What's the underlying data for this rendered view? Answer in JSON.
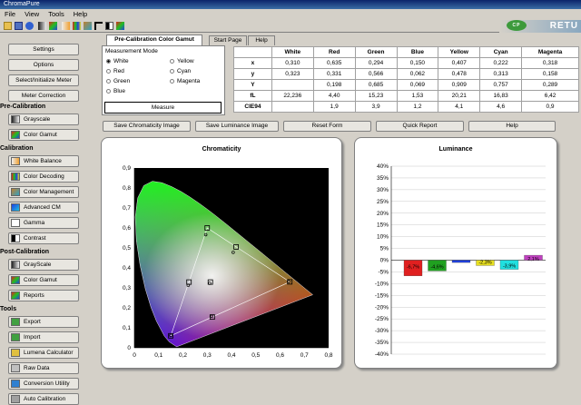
{
  "window": {
    "title": "ChromaPure",
    "brand": "RETU",
    "logo_text": "CP"
  },
  "menu": [
    "File",
    "View",
    "Tools",
    "Help"
  ],
  "left": {
    "top_buttons": [
      "Settings",
      "Options",
      "Select/Initialize Meter",
      "Meter Correction"
    ],
    "sections": [
      {
        "title": "Pre-Calibration",
        "buttons": [
          {
            "label": "Grayscale",
            "icon": "grayscale-icon"
          },
          {
            "label": "Color Gamut",
            "icon": "color-gamut-icon"
          }
        ]
      },
      {
        "title": "Calibration",
        "buttons": [
          {
            "label": "White Balance",
            "icon": "white-balance-icon"
          },
          {
            "label": "Color Decoding",
            "icon": "color-decoding-icon"
          },
          {
            "label": "Color Management",
            "icon": "color-management-icon"
          },
          {
            "label": "Advanced CM",
            "icon": "advanced-cm-icon"
          },
          {
            "label": "Gamma",
            "icon": "gamma-icon"
          },
          {
            "label": "Contrast",
            "icon": "contrast-icon"
          }
        ]
      },
      {
        "title": "Post-Calibration",
        "buttons": [
          {
            "label": "GrayScale",
            "icon": "grayscale-icon"
          },
          {
            "label": "Color Gamut",
            "icon": "color-gamut-icon"
          },
          {
            "label": "Reports",
            "icon": "reports-icon"
          }
        ]
      },
      {
        "title": "Tools",
        "buttons": [
          {
            "label": "Export",
            "icon": "export-icon"
          },
          {
            "label": "Import",
            "icon": "import-icon"
          },
          {
            "label": "Lumena Calculator",
            "icon": "calculator-icon"
          },
          {
            "label": "Raw Data",
            "icon": "raw-data-icon"
          },
          {
            "label": "Conversion Utility",
            "icon": "conversion-icon"
          },
          {
            "label": "Auto Calibration",
            "icon": "auto-calibration-icon"
          }
        ]
      }
    ]
  },
  "tabs": [
    "Pre-Calibration Color Gamut",
    "Start Page",
    "Help"
  ],
  "measurement": {
    "title": "Measurement Mode",
    "options": [
      "White",
      "Red",
      "Green",
      "Blue",
      "Yellow",
      "Cyan",
      "Magenta"
    ],
    "selected": "White",
    "measure_label": "Measure"
  },
  "table": {
    "columns": [
      "",
      "White",
      "Red",
      "Green",
      "Blue",
      "Yellow",
      "Cyan",
      "Magenta"
    ],
    "rows": [
      [
        "x",
        "0,310",
        "0,635",
        "0,294",
        "0,150",
        "0,407",
        "0,222",
        "0,318"
      ],
      [
        "y",
        "0,323",
        "0,331",
        "0,566",
        "0,062",
        "0,478",
        "0,313",
        "0,158"
      ],
      [
        "Y",
        "",
        "0,198",
        "0,685",
        "0,069",
        "0,909",
        "0,757",
        "0,289"
      ],
      [
        "fL",
        "22,236",
        "4,40",
        "15,23",
        "1,53",
        "20,21",
        "16,83",
        "6,42"
      ],
      [
        "CIE94",
        "",
        "1,9",
        "3,9",
        "1,2",
        "4,1",
        "4,6",
        "0,9"
      ]
    ]
  },
  "actions": [
    "Save Chromaticity Image",
    "Save Luminance Image",
    "Reset Form",
    "Quick Report",
    "Help"
  ],
  "chromaticity": {
    "title": "Chromaticity",
    "x_ticks": [
      "0",
      "0,1",
      "0,2",
      "0,3",
      "0,4",
      "0,5",
      "0,6",
      "0,7",
      "0,8"
    ],
    "y_ticks": [
      "0",
      "0,1",
      "0,2",
      "0,3",
      "0,4",
      "0,5",
      "0,6",
      "0,7",
      "0,8",
      "0,9"
    ],
    "targets": [
      {
        "name": "Red",
        "x": 0.64,
        "y": 0.33
      },
      {
        "name": "Green",
        "x": 0.3,
        "y": 0.6
      },
      {
        "name": "Blue",
        "x": 0.15,
        "y": 0.06
      },
      {
        "name": "Yellow",
        "x": 0.419,
        "y": 0.505
      },
      {
        "name": "Cyan",
        "x": 0.225,
        "y": 0.329
      },
      {
        "name": "Magenta",
        "x": 0.321,
        "y": 0.154
      },
      {
        "name": "White",
        "x": 0.313,
        "y": 0.329
      }
    ],
    "measured": [
      {
        "name": "Red",
        "x": 0.635,
        "y": 0.331
      },
      {
        "name": "Green",
        "x": 0.294,
        "y": 0.566
      },
      {
        "name": "Blue",
        "x": 0.15,
        "y": 0.062
      },
      {
        "name": "Yellow",
        "x": 0.407,
        "y": 0.478
      },
      {
        "name": "Cyan",
        "x": 0.222,
        "y": 0.313
      },
      {
        "name": "Magenta",
        "x": 0.318,
        "y": 0.158
      },
      {
        "name": "White",
        "x": 0.31,
        "y": 0.323
      }
    ]
  },
  "luminance": {
    "title": "Luminance",
    "y_ticks": [
      "40%",
      "35%",
      "30%",
      "25%",
      "20%",
      "15%",
      "10%",
      "5%",
      "0%",
      "-5%",
      "-10%",
      "-15%",
      "-20%",
      "-25%",
      "-30%",
      "-35%",
      "-40%"
    ],
    "bars": [
      {
        "name": "Red",
        "value": -6.7,
        "label": "-6,7%",
        "color": "#e02020"
      },
      {
        "name": "Green",
        "value": -4.6,
        "label": "-4,6%",
        "color": "#20a020"
      },
      {
        "name": "Blue",
        "value": -1.0,
        "label": "",
        "color": "#2040e0"
      },
      {
        "name": "Yellow",
        "value": -2.3,
        "label": "-2,3%",
        "color": "#e8e020"
      },
      {
        "name": "Cyan",
        "value": -3.9,
        "label": "-3,9%",
        "color": "#20e0e0"
      },
      {
        "name": "Magenta",
        "value": 2.1,
        "label": "2,1%",
        "color": "#c040c0"
      }
    ]
  },
  "chart_data": [
    {
      "type": "scatter",
      "title": "Chromaticity",
      "xlim": [
        0,
        0.8
      ],
      "ylim": [
        0,
        0.9
      ],
      "series": [
        {
          "name": "Measured",
          "points": [
            [
              0.635,
              0.331
            ],
            [
              0.294,
              0.566
            ],
            [
              0.15,
              0.062
            ],
            [
              0.407,
              0.478
            ],
            [
              0.222,
              0.313
            ],
            [
              0.318,
              0.158
            ],
            [
              0.31,
              0.323
            ]
          ]
        }
      ]
    },
    {
      "type": "bar",
      "title": "Luminance",
      "categories": [
        "Red",
        "Green",
        "Blue",
        "Yellow",
        "Cyan",
        "Magenta"
      ],
      "values": [
        -6.7,
        -4.6,
        -1.0,
        -2.3,
        -3.9,
        2.1
      ],
      "ylim": [
        -40,
        40
      ]
    }
  ]
}
